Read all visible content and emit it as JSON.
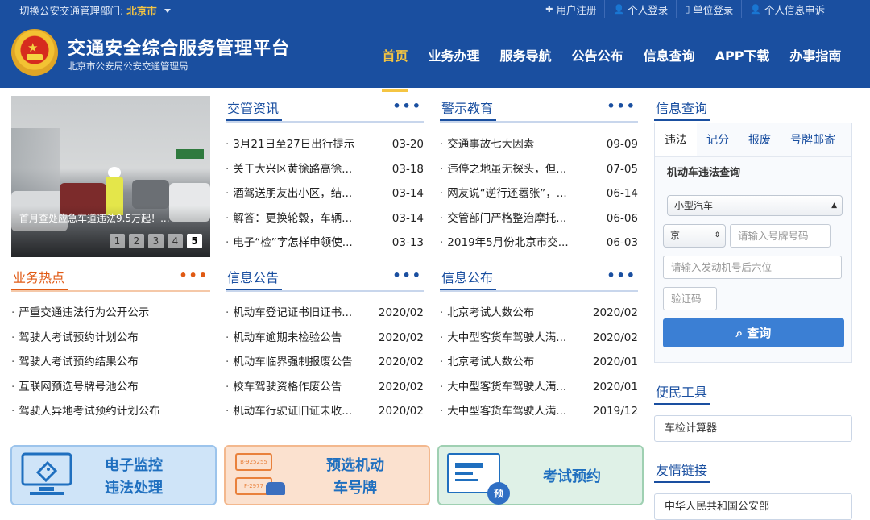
{
  "topbar": {
    "dept_label": "切换公安交通管理部门:",
    "dept_value": "北京市",
    "links": [
      {
        "icon": "plus-icon",
        "label": "用户注册"
      },
      {
        "icon": "user-icon",
        "label": "个人登录"
      },
      {
        "icon": "building-icon",
        "label": "单位登录"
      },
      {
        "icon": "user-icon",
        "label": "个人信息申诉"
      }
    ]
  },
  "header": {
    "title": "交通安全综合服务管理平台",
    "subtitle": "北京市公安局公安交通管理局"
  },
  "nav": [
    "首页",
    "业务办理",
    "服务导航",
    "公告公布",
    "信息查询",
    "APP下载",
    "办事指南"
  ],
  "banner": {
    "caption": "首月查处应急车道违法9.5万起！...",
    "pages": [
      "1",
      "2",
      "3",
      "4",
      "5"
    ]
  },
  "sections": {
    "jiaoguan": {
      "title": "交管资讯",
      "more": "•••",
      "items": [
        {
          "t": "3月21日至27日出行提示",
          "d": "03-20"
        },
        {
          "t": "关于大兴区黄徐路高徐...",
          "d": "03-18"
        },
        {
          "t": "酒驾送朋友出小区，结...",
          "d": "03-14"
        },
        {
          "t": "解答：更换轮毂，车辆...",
          "d": "03-14"
        },
        {
          "t": "电子“检”字怎样申领使...",
          "d": "03-13"
        }
      ]
    },
    "jingshi": {
      "title": "警示教育",
      "more": "•••",
      "items": [
        {
          "t": "交通事故七大因素",
          "d": "09-09"
        },
        {
          "t": "违停之地虽无探头，但...",
          "d": "07-05"
        },
        {
          "t": "网友说“逆行还嚣张”，...",
          "d": "06-14"
        },
        {
          "t": "交管部门严格整治摩托...",
          "d": "06-06"
        },
        {
          "t": "2019年5月份北京市交...",
          "d": "06-03"
        }
      ]
    },
    "yewu": {
      "title": "业务热点",
      "more": "•••",
      "items": [
        {
          "t": "严重交通违法行为公开公示",
          "d": ""
        },
        {
          "t": "驾驶人考试预约计划公布",
          "d": ""
        },
        {
          "t": "驾驶人考试预约结果公布",
          "d": ""
        },
        {
          "t": "互联网预选号牌号池公布",
          "d": ""
        },
        {
          "t": "驾驶人异地考试预约计划公布",
          "d": ""
        }
      ]
    },
    "xinxigg": {
      "title": "信息公告",
      "more": "•••",
      "items": [
        {
          "t": "机动车登记证书旧证书...",
          "d": "2020/02"
        },
        {
          "t": "机动车逾期未检验公告",
          "d": "2020/02"
        },
        {
          "t": "机动车临界强制报废公告",
          "d": "2020/02"
        },
        {
          "t": "校车驾驶资格作废公告",
          "d": "2020/02"
        },
        {
          "t": "机动车行驶证旧证未收...",
          "d": "2020/02"
        }
      ]
    },
    "xinxigb": {
      "title": "信息公布",
      "more": "•••",
      "items": [
        {
          "t": "北京考试人数公布",
          "d": "2020/02"
        },
        {
          "t": "大中型客货车驾驶人满...",
          "d": "2020/02"
        },
        {
          "t": "北京考试人数公布",
          "d": "2020/01"
        },
        {
          "t": "大中型客货车驾驶人满...",
          "d": "2020/01"
        },
        {
          "t": "大中型客货车驾驶人满...",
          "d": "2019/12"
        }
      ]
    }
  },
  "query": {
    "title": "信息查询",
    "tabs": [
      "违法",
      "记分",
      "报废",
      "号牌邮寄"
    ],
    "form_title": "机动车违法查询",
    "vehicle_type": "小型汽车",
    "province": "京",
    "plate_placeholder": "请输入号牌号码",
    "engine_placeholder": "请输入发动机号后六位",
    "captcha_placeholder": "验证码",
    "button": "查询"
  },
  "tools": {
    "title": "便民工具",
    "item": "车检计算器"
  },
  "links": {
    "title": "友情链接",
    "item": "中华人民共和国公安部"
  },
  "cards": [
    {
      "line1": "电子监控",
      "line2": "违法处理",
      "icon": "monitor-icon"
    },
    {
      "line1": "预选机动",
      "line2": "车号牌",
      "icon": "plate-car-icon",
      "plate1": "B·925255",
      "plate2": "F·2977"
    },
    {
      "line1": "考试预约",
      "line2": "",
      "icon": "exam-card-icon",
      "badge": "预"
    }
  ],
  "colors": {
    "primary": "#1a4fa0",
    "accent": "#f5c542",
    "orange": "#e05a14",
    "button": "#3b7fd4"
  }
}
